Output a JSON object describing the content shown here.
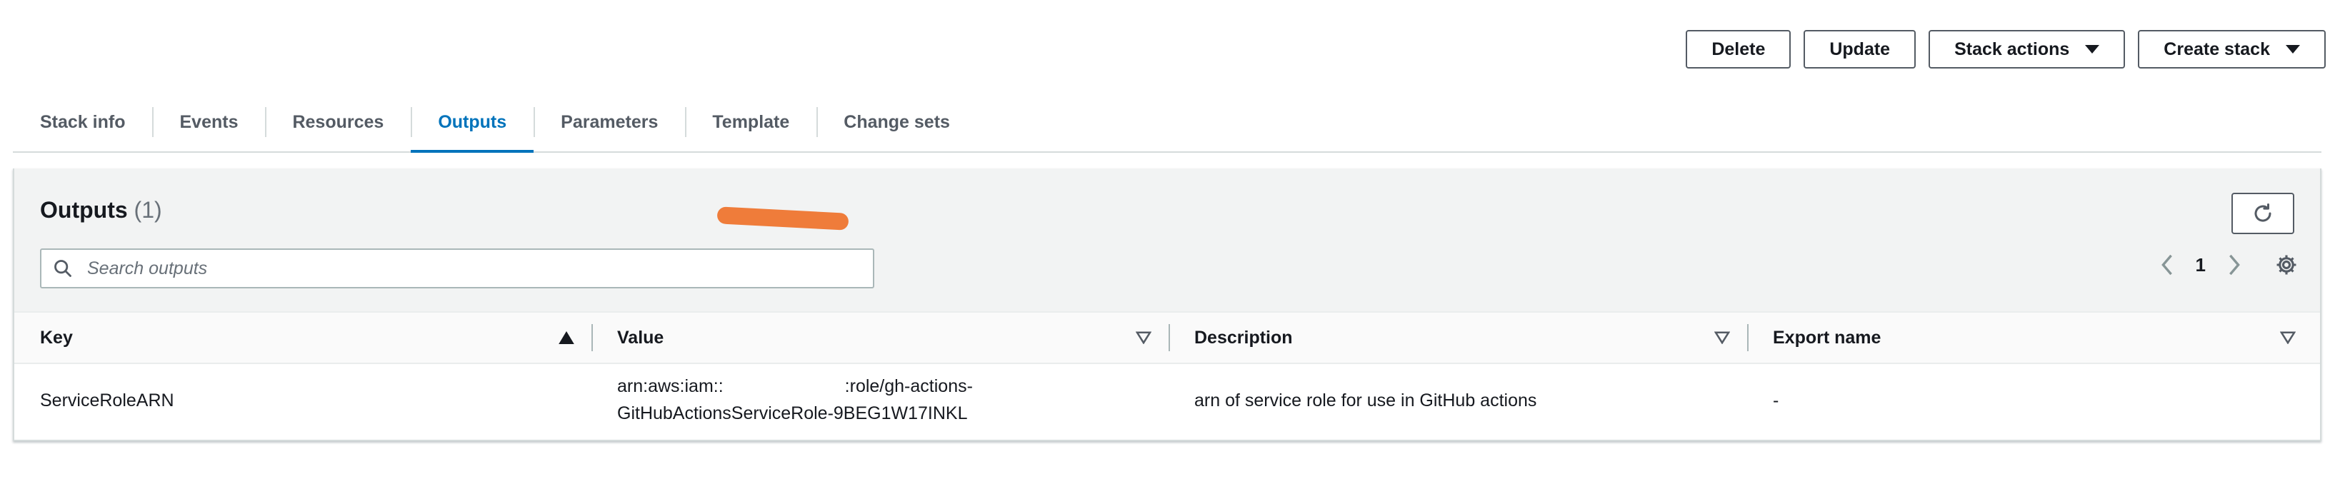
{
  "actions": {
    "delete": "Delete",
    "update": "Update",
    "stack_actions": "Stack actions",
    "create_stack": "Create stack"
  },
  "tabs": [
    "Stack info",
    "Events",
    "Resources",
    "Outputs",
    "Parameters",
    "Template",
    "Change sets"
  ],
  "active_tab": "Outputs",
  "outputs": {
    "title": "Outputs",
    "count": "(1)",
    "search_placeholder": "Search outputs",
    "page": "1",
    "columns": [
      "Key",
      "Value",
      "Description",
      "Export name"
    ],
    "rows": [
      {
        "key": "ServiceRoleARN",
        "value_line1": "arn:aws:iam::",
        "value_line1_tail": ":role/gh-actions-",
        "value_line2": "GitHubActionsServiceRole-9BEG1W17INKL",
        "description": "arn of service role for use in GitHub actions",
        "export_name": "-"
      }
    ]
  },
  "colors": {
    "accent": "#0073bb",
    "redaction": "#ef7c3a"
  }
}
